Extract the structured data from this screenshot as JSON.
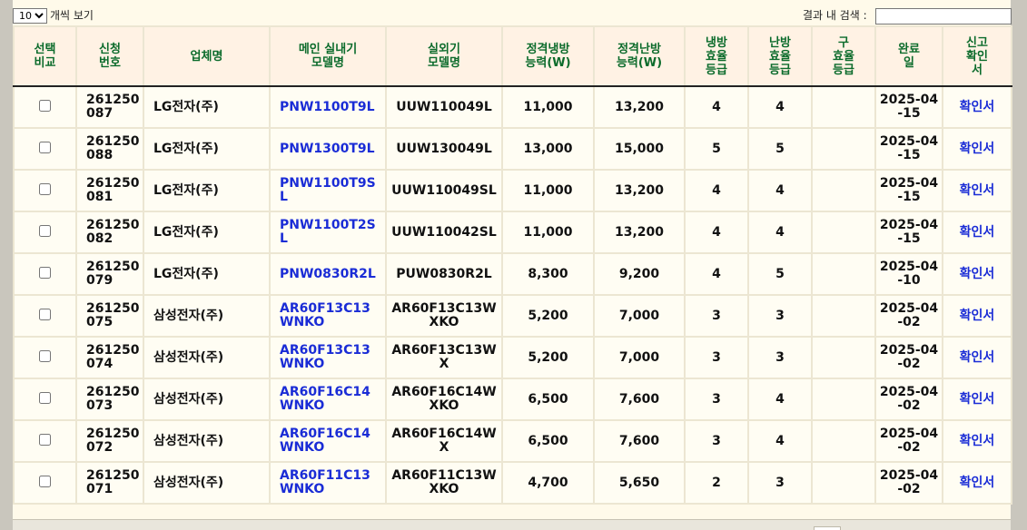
{
  "toolbar": {
    "page_length_value": "10",
    "page_length_options": [
      "10"
    ],
    "page_length_label": "개씩 보기",
    "search_label": "결과 내 검색 :",
    "search_value": ""
  },
  "table": {
    "headers": [
      "선택\n비교",
      "신청\n번호",
      "업체명",
      "메인 실내기\n모델명",
      "실외기\n모델명",
      "정격냉방\n능력(W)",
      "정격난방\n능력(W)",
      "냉방\n효율\n등급",
      "난방\n효율\n등급",
      "구\n효율\n등급",
      "완료\n일",
      "신고\n확인\n서"
    ],
    "rows": [
      {
        "app_no": "261250087",
        "company": "LG전자(주)",
        "main_model": "PNW1100T9L",
        "outdoor_model": "UUW110049L",
        "cool_w": "11,000",
        "heat_w": "13,200",
        "cool_grade": "4",
        "heat_grade": "4",
        "old_grade": "",
        "done_date": "2025-04-15",
        "confirm": "확인서"
      },
      {
        "app_no": "261250088",
        "company": "LG전자(주)",
        "main_model": "PNW1300T9L",
        "outdoor_model": "UUW130049L",
        "cool_w": "13,000",
        "heat_w": "15,000",
        "cool_grade": "5",
        "heat_grade": "5",
        "old_grade": "",
        "done_date": "2025-04-15",
        "confirm": "확인서"
      },
      {
        "app_no": "261250081",
        "company": "LG전자(주)",
        "main_model": "PNW1100T9SL",
        "outdoor_model": "UUW110049SL",
        "cool_w": "11,000",
        "heat_w": "13,200",
        "cool_grade": "4",
        "heat_grade": "4",
        "old_grade": "",
        "done_date": "2025-04-15",
        "confirm": "확인서"
      },
      {
        "app_no": "261250082",
        "company": "LG전자(주)",
        "main_model": "PNW1100T2SL",
        "outdoor_model": "UUW110042SL",
        "cool_w": "11,000",
        "heat_w": "13,200",
        "cool_grade": "4",
        "heat_grade": "4",
        "old_grade": "",
        "done_date": "2025-04-15",
        "confirm": "확인서"
      },
      {
        "app_no": "261250079",
        "company": "LG전자(주)",
        "main_model": "PNW0830R2L",
        "outdoor_model": "PUW0830R2L",
        "cool_w": "8,300",
        "heat_w": "9,200",
        "cool_grade": "4",
        "heat_grade": "5",
        "old_grade": "",
        "done_date": "2025-04-10",
        "confirm": "확인서"
      },
      {
        "app_no": "261250075",
        "company": "삼성전자(주)",
        "main_model": "AR60F13C13WNKO",
        "outdoor_model": "AR60F13C13WXKO",
        "cool_w": "5,200",
        "heat_w": "7,000",
        "cool_grade": "3",
        "heat_grade": "3",
        "old_grade": "",
        "done_date": "2025-04-02",
        "confirm": "확인서"
      },
      {
        "app_no": "261250074",
        "company": "삼성전자(주)",
        "main_model": "AR60F13C13WNKO",
        "outdoor_model": "AR60F13C13WX",
        "cool_w": "5,200",
        "heat_w": "7,000",
        "cool_grade": "3",
        "heat_grade": "3",
        "old_grade": "",
        "done_date": "2025-04-02",
        "confirm": "확인서"
      },
      {
        "app_no": "261250073",
        "company": "삼성전자(주)",
        "main_model": "AR60F16C14WNKO",
        "outdoor_model": "AR60F16C14WXKO",
        "cool_w": "6,500",
        "heat_w": "7,600",
        "cool_grade": "3",
        "heat_grade": "4",
        "old_grade": "",
        "done_date": "2025-04-02",
        "confirm": "확인서"
      },
      {
        "app_no": "261250072",
        "company": "삼성전자(주)",
        "main_model": "AR60F16C14WNKO",
        "outdoor_model": "AR60F16C14WX",
        "cool_w": "6,500",
        "heat_w": "7,600",
        "cool_grade": "3",
        "heat_grade": "4",
        "old_grade": "",
        "done_date": "2025-04-02",
        "confirm": "확인서"
      },
      {
        "app_no": "261250071",
        "company": "삼성전자(주)",
        "main_model": "AR60F11C13WNKO",
        "outdoor_model": "AR60F11C13WXKO",
        "cool_w": "4,700",
        "heat_w": "5,650",
        "cool_grade": "2",
        "heat_grade": "3",
        "old_grade": "",
        "done_date": "2025-04-02",
        "confirm": "확인서"
      }
    ]
  }
}
